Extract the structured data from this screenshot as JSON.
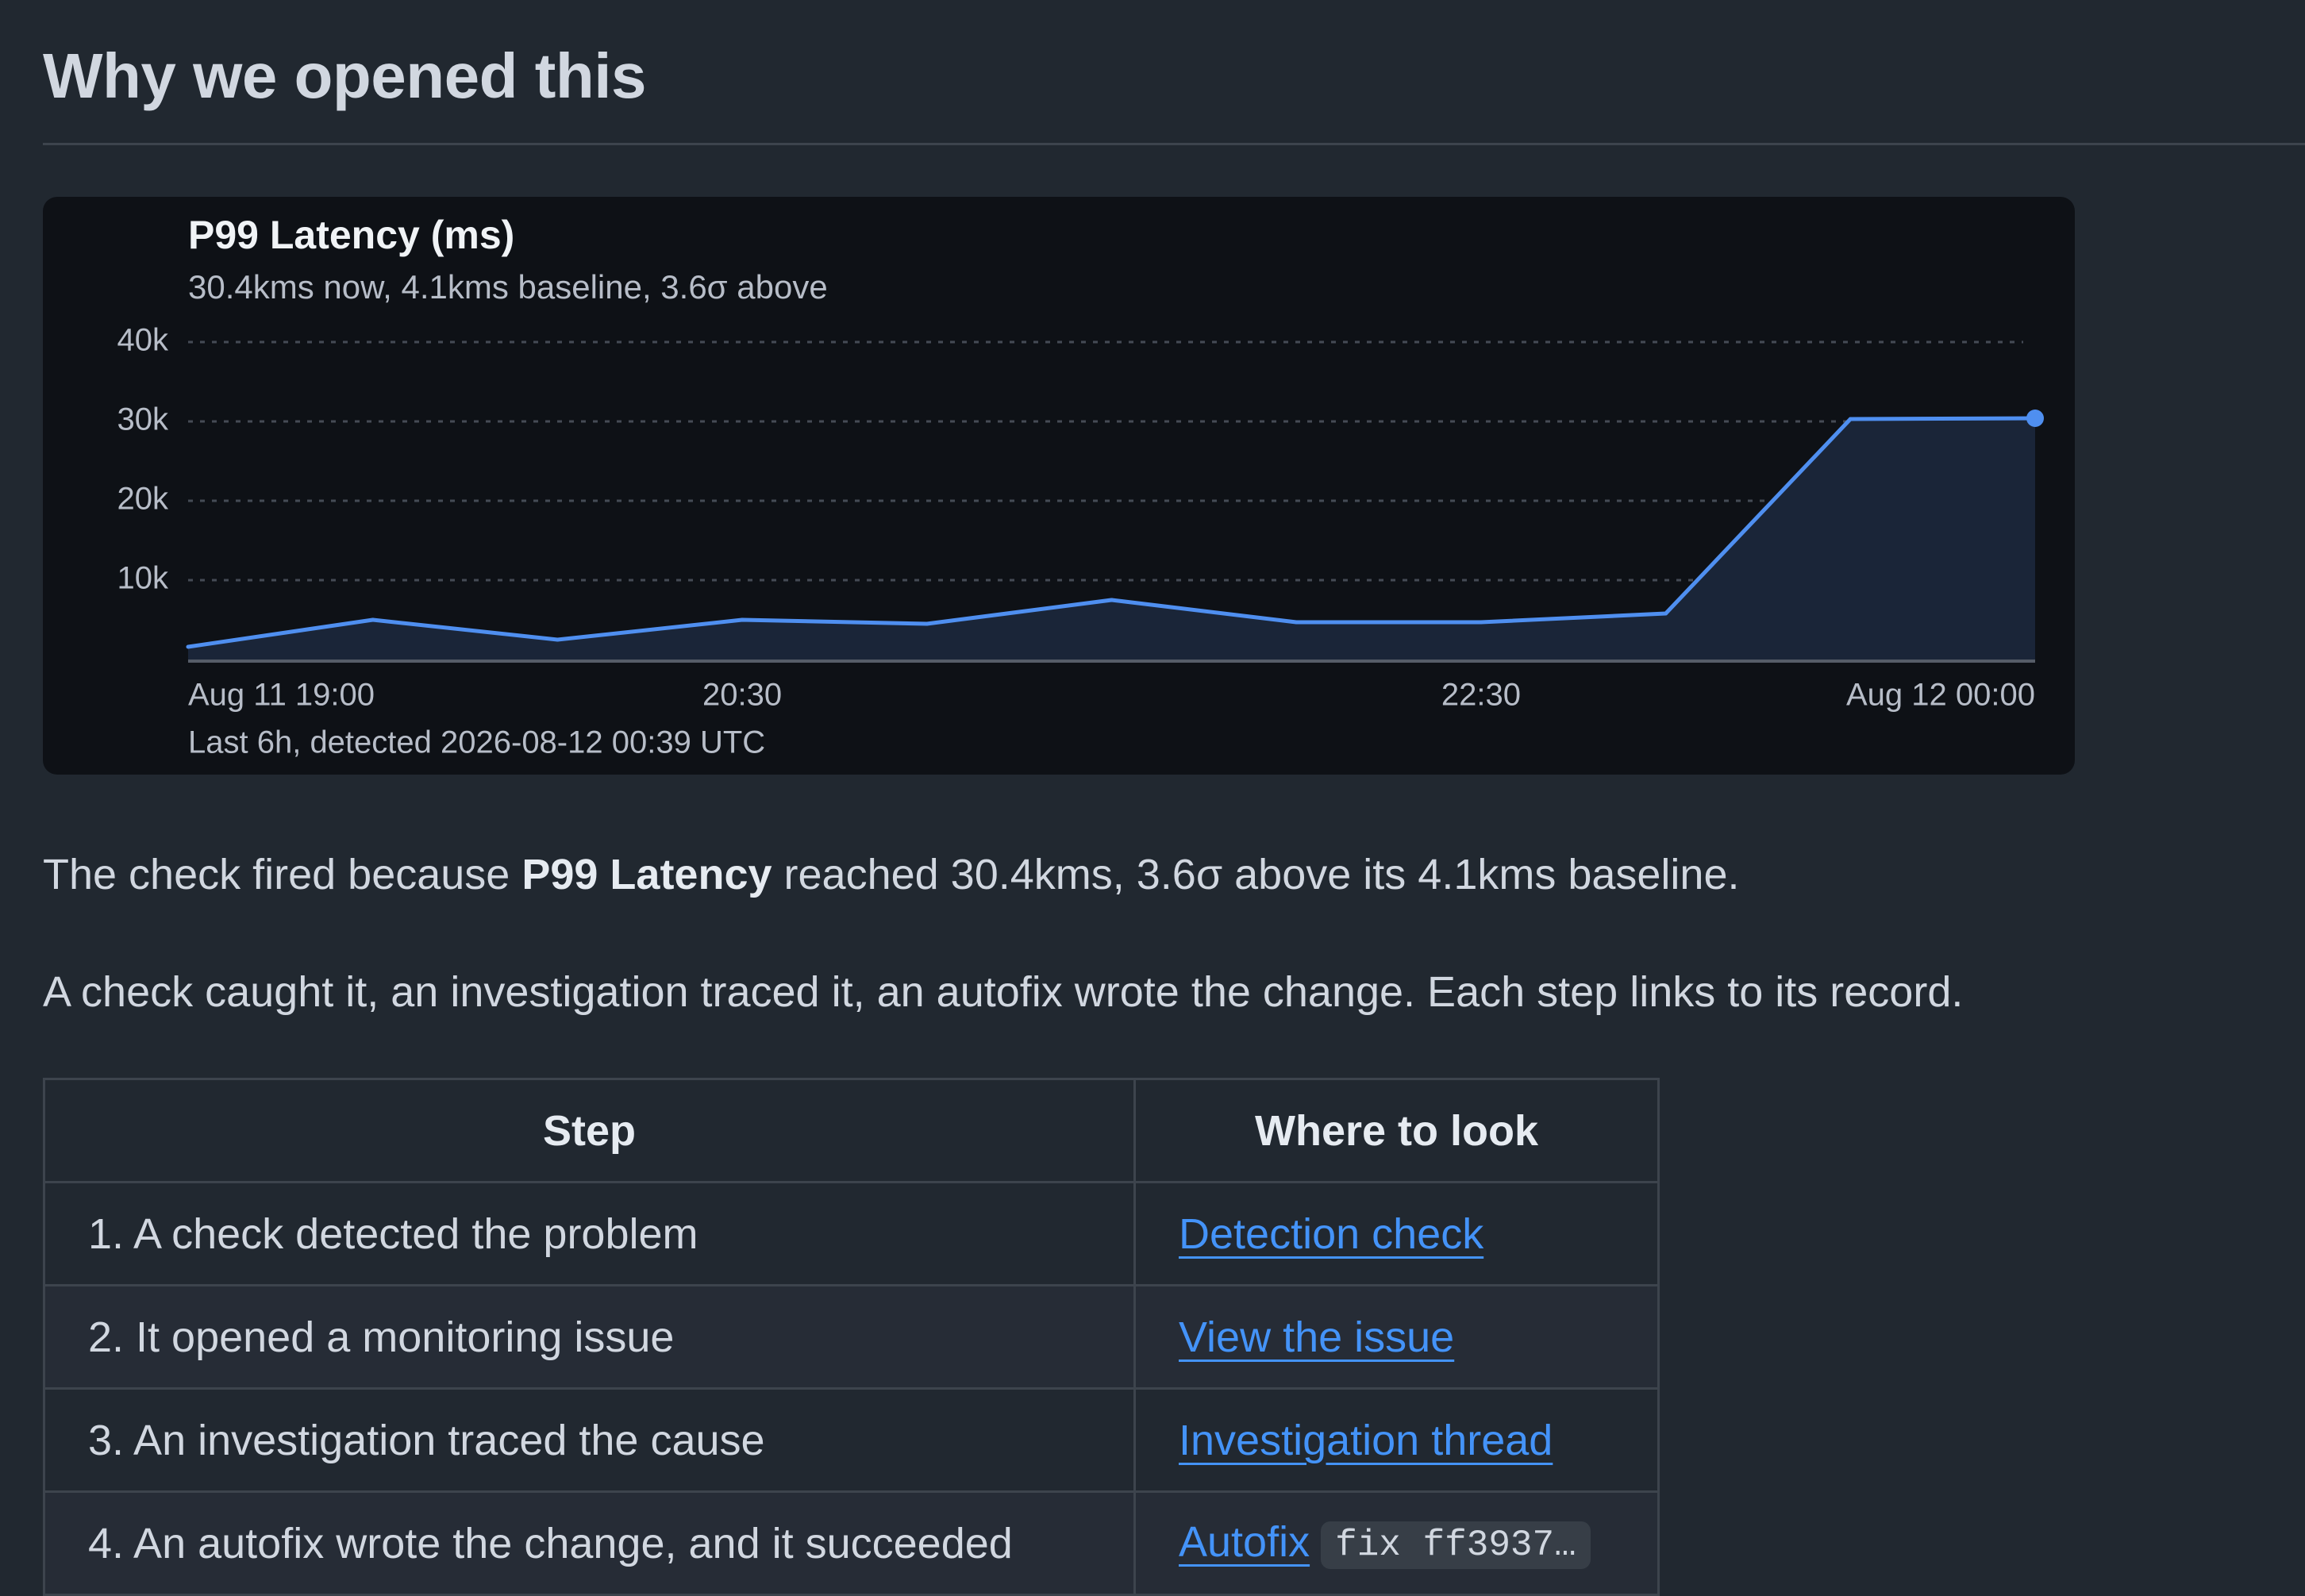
{
  "section": {
    "title": "Why we opened this"
  },
  "chart_data": {
    "type": "area",
    "title": "P99 Latency (ms)",
    "subtitle": "30.4kms now, 4.1kms baseline, 3.6σ above",
    "footer": "Last 6h, detected 2026-08-12 00:39 UTC",
    "x_ticks": [
      "Aug 11 19:00",
      "20:30",
      "22:30",
      "Aug 12 00:00"
    ],
    "y_ticks": [
      "40k",
      "30k",
      "20k",
      "10k"
    ],
    "ylim": [
      0,
      40000
    ],
    "grid": true,
    "series": [
      {
        "x": [
          "Aug 11 19:00",
          "Aug 11 19:30",
          "Aug 11 20:00",
          "Aug 11 20:30",
          "Aug 11 21:00",
          "Aug 11 21:30",
          "Aug 11 22:00",
          "Aug 11 22:30",
          "Aug 11 23:00",
          "Aug 11 23:30",
          "Aug 12 00:00"
        ],
        "values": [
          1600,
          5000,
          2500,
          5000,
          4500,
          7500,
          4700,
          4700,
          5800,
          30300,
          30400
        ]
      }
    ],
    "line_color": "#4f8ff0",
    "fill_color": "#1a2538"
  },
  "paragraphs": {
    "p1_before": "The check fired because ",
    "p1_bold": "P99 Latency",
    "p1_after": " reached 30.4kms, 3.6σ above its 4.1kms baseline.",
    "p2": "A check caught it, an investigation traced it, an autofix wrote the change. Each step links to its record."
  },
  "table": {
    "headers": [
      "Step",
      "Where to look"
    ],
    "rows": [
      {
        "step": "1. A check detected the problem",
        "link": "Detection check",
        "code": ""
      },
      {
        "step": "2. It opened a monitoring issue",
        "link": "View the issue",
        "code": ""
      },
      {
        "step": "3. An investigation traced the cause",
        "link": "Investigation thread",
        "code": ""
      },
      {
        "step": "4. An autofix wrote the change, and it succeeded",
        "link": "Autofix",
        "code": "fix ff3937…"
      }
    ]
  }
}
